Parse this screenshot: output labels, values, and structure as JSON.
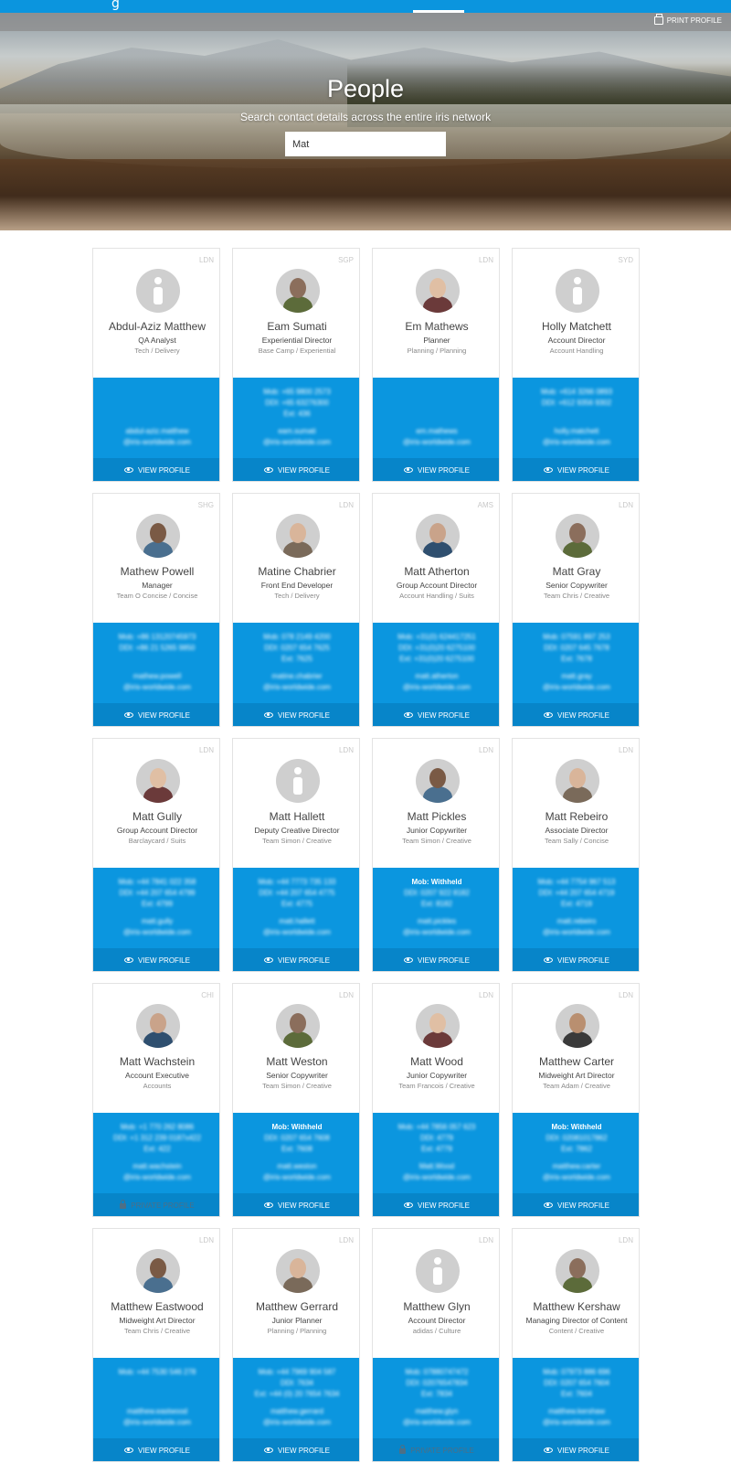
{
  "header": {
    "logo": "g",
    "print_label": "PRINT PROFILE"
  },
  "hero": {
    "title": "People",
    "subtitle": "Search contact details across the entire iris network",
    "search_value": "Mat"
  },
  "colors": {
    "accent": "#0b96df",
    "footer": "#0785c9"
  },
  "people": [
    {
      "name": "Abdul-Aziz Matthew",
      "title": "QA Analyst",
      "team": "Tech / Delivery",
      "office": "LDN",
      "avatar": "default",
      "contacts": [
        "",
        "",
        ""
      ],
      "email1": "abdul-aziz.matthew",
      "email2": "@iris-worldwide.com",
      "action": "VIEW PROFILE",
      "private": false
    },
    {
      "name": "Eam Sumati",
      "title": "Experiential Director",
      "team": "Base Camp / Experiential",
      "office": "SGP",
      "avatar": "photo",
      "contacts": [
        "Mob: +65 9800 2573",
        "DDI: +65 63276300",
        "Ext: 436"
      ],
      "email1": "eam.sumati",
      "email2": "@iris-worldwide.com",
      "action": "VIEW PROFILE",
      "private": false
    },
    {
      "name": "Em Mathews",
      "title": "Planner",
      "team": "Planning / Planning",
      "office": "LDN",
      "avatar": "photo",
      "contacts": [
        "",
        "",
        ""
      ],
      "email1": "em.mathews",
      "email2": "@iris-worldwide.com",
      "action": "VIEW PROFILE",
      "private": false
    },
    {
      "name": "Holly Matchett",
      "title": "Account Director",
      "team": "Account Handling",
      "office": "SYD",
      "avatar": "default",
      "contacts": [
        "Mob: +614 3266 0893",
        "DDI: +612 9356 9302",
        ""
      ],
      "email1": "holly.matchett",
      "email2": "@iris-worldwide.com",
      "action": "VIEW PROFILE",
      "private": false
    },
    {
      "name": "Mathew Powell",
      "title": "Manager",
      "team": "Team O Concise / Concise",
      "office": "SHG",
      "avatar": "photo",
      "contacts": [
        "Mob: +86 13120745973",
        "DDI: +86 21 5265 9850",
        ""
      ],
      "email1": "mathew.powell",
      "email2": "@iris-worldwide.com",
      "action": "VIEW PROFILE",
      "private": false
    },
    {
      "name": "Matine Chabrier",
      "title": "Front End Developer",
      "team": "Tech / Delivery",
      "office": "LDN",
      "avatar": "photo",
      "contacts": [
        "Mob: 078 2149 4200",
        "DDI: 0207 654 7625",
        "Ext: 7625"
      ],
      "email1": "matine.chabrier",
      "email2": "@iris-worldwide.com",
      "action": "VIEW PROFILE",
      "private": false
    },
    {
      "name": "Matt Atherton",
      "title": "Group Account Director",
      "team": "Account Handling / Suits",
      "office": "AMS",
      "avatar": "photo",
      "contacts": [
        "Mob: +31(0) 624417251",
        "DDI: +31(0)20 6275100",
        "Ext: +31(0)20 6275100"
      ],
      "email1": "matt.atherton",
      "email2": "@iris-worldwide.com",
      "action": "VIEW PROFILE",
      "private": false
    },
    {
      "name": "Matt Gray",
      "title": "Senior Copywriter",
      "team": "Team Chris / Creative",
      "office": "LDN",
      "avatar": "photo",
      "contacts": [
        "Mob: 07591 897 253",
        "DDI: 0207 645 7678",
        "Ext: 7678"
      ],
      "email1": "matt.gray",
      "email2": "@iris-worldwide.com",
      "action": "VIEW PROFILE",
      "private": false
    },
    {
      "name": "Matt Gully",
      "title": "Group Account Director",
      "team": "Barclaycard / Suits",
      "office": "LDN",
      "avatar": "photo",
      "contacts": [
        "Mob: +44 7841 022 358",
        "DDI: +44 207 654 4799",
        "Ext: 4799"
      ],
      "email1": "matt.gully",
      "email2": "@iris-worldwide.com",
      "action": "VIEW PROFILE",
      "private": false
    },
    {
      "name": "Matt Hallett",
      "title": "Deputy Creative Director",
      "team": "Team Simon / Creative",
      "office": "LDN",
      "avatar": "default",
      "contacts": [
        "Mob: +44 7773 735 133",
        "DDI: +44 207 654 4775",
        "Ext: 4775"
      ],
      "email1": "matt.hallett",
      "email2": "@iris-worldwide.com",
      "action": "VIEW PROFILE",
      "private": false
    },
    {
      "name": "Matt Pickles",
      "title": "Junior Copywriter",
      "team": "Team Simon / Creative",
      "office": "LDN",
      "avatar": "photo",
      "contacts": [
        "Mob: Withheld",
        "DDI: 0207 922 8182",
        "Ext: 8182"
      ],
      "email1": "matt.pickles",
      "email2": "@iris-worldwide.com",
      "action": "VIEW PROFILE",
      "private": false
    },
    {
      "name": "Matt Rebeiro",
      "title": "Associate Director",
      "team": "Team Sally / Concise",
      "office": "LDN",
      "avatar": "photo",
      "contacts": [
        "Mob: +44 7754 967 513",
        "DDI: +44 207 654 4719",
        "Ext: 4719"
      ],
      "email1": "matt.rebeiro",
      "email2": "@iris-worldwide.com",
      "action": "VIEW PROFILE",
      "private": false
    },
    {
      "name": "Matt Wachstein",
      "title": "Account Executive",
      "team": "Accounts",
      "office": "CHI",
      "avatar": "photo",
      "contacts": [
        "Mob: +1 770 262 8086",
        "DDI: +1 312 239 0187x422",
        "Ext: 422"
      ],
      "email1": "matt.wachstein",
      "email2": "@iris-worldwide.com",
      "action": "PRIVATE PROFILE",
      "private": true
    },
    {
      "name": "Matt Weston",
      "title": "Senior Copywriter",
      "team": "Team Simon / Creative",
      "office": "LDN",
      "avatar": "photo",
      "contacts": [
        "Mob: Withheld",
        "DDI: 0207 654 7608",
        "Ext: 7608"
      ],
      "email1": "matt.weston",
      "email2": "@iris-worldwide.com",
      "action": "VIEW PROFILE",
      "private": false
    },
    {
      "name": "Matt Wood",
      "title": "Junior Copywriter",
      "team": "Team Francois / Creative",
      "office": "LDN",
      "avatar": "photo",
      "contacts": [
        "Mob: +44 7856 057 623",
        "DDI: 4779",
        "Ext: 4779"
      ],
      "email1": "Matt.Wood",
      "email2": "@iris-worldwide.com",
      "action": "VIEW PROFILE",
      "private": false
    },
    {
      "name": "Matthew Carter",
      "title": "Midweight Art Director",
      "team": "Team Adam / Creative",
      "office": "LDN",
      "avatar": "photo",
      "contacts": [
        "Mob: Withheld",
        "DDI: 02081017862",
        "Ext: 7862"
      ],
      "email1": "matthew.carter",
      "email2": "@iris-worldwide.com",
      "action": "VIEW PROFILE",
      "private": false
    },
    {
      "name": "Matthew Eastwood",
      "title": "Midweight Art Director",
      "team": "Team Chris / Creative",
      "office": "LDN",
      "avatar": "photo",
      "contacts": [
        "Mob: +44 7530 546 278",
        "",
        ""
      ],
      "email1": "matthew.eastwood",
      "email2": "@iris-worldwide.com",
      "action": "VIEW PROFILE",
      "private": false
    },
    {
      "name": "Matthew Gerrard",
      "title": "Junior Planner",
      "team": "Planning / Planning",
      "office": "LDN",
      "avatar": "photo",
      "contacts": [
        "Mob: +44 7969 904 587",
        "DDI: 7634",
        "Ext: +44 (0) 20 7654 7634"
      ],
      "email1": "matthew.gerrard",
      "email2": "@iris-worldwide.com",
      "action": "VIEW PROFILE",
      "private": false
    },
    {
      "name": "Matthew Glyn",
      "title": "Account Director",
      "team": "adidas / Culture",
      "office": "LDN",
      "avatar": "default",
      "contacts": [
        "Mob: 07880747472",
        "DDI: 02076547834",
        "Ext: 7834"
      ],
      "email1": "matthew.glyn",
      "email2": "@iris-worldwide.com",
      "action": "PRIVATE PROFILE",
      "private": true
    },
    {
      "name": "Matthew Kershaw",
      "title": "Managing Director of Content",
      "team": "Content / Creative",
      "office": "LDN",
      "avatar": "photo",
      "contacts": [
        "Mob: 07973 886 696",
        "DDI: 0207 654 7604",
        "Ext: 7604"
      ],
      "email1": "matthew.kershaw",
      "email2": "@iris-worldwide.com",
      "action": "VIEW PROFILE",
      "private": false
    }
  ]
}
